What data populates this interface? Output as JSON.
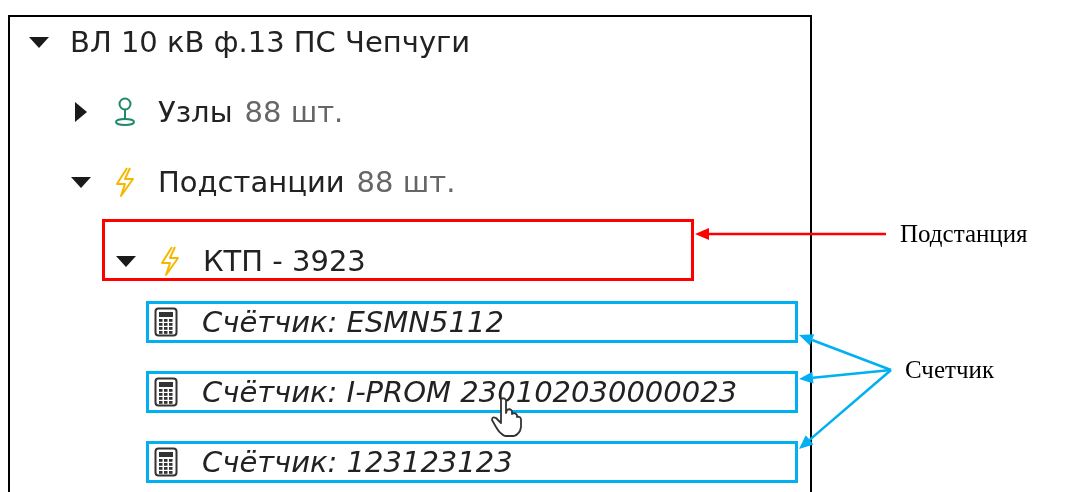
{
  "tree": [
    {
      "label": "ВЛ 10 кВ ф.13 ПС Чепчуги",
      "expanded": true,
      "children": [
        {
          "label": "Узлы",
          "count": "88 шт.",
          "kind": "nodes",
          "expanded": false
        },
        {
          "label": "Подстанции",
          "count": "88 шт.",
          "kind": "substations",
          "expanded": true,
          "children": [
            {
              "label": "КТП - 3923",
              "kind": "substation",
              "expanded": true,
              "marked": true,
              "children": [
                {
                  "label": "Счётчик: ESMN5112",
                  "kind": "meter",
                  "marked": true
                },
                {
                  "label": "Счётчик: I-PROM 230102030000023",
                  "kind": "meter",
                  "marked": true
                },
                {
                  "label": "Счётчик: 123123123",
                  "kind": "meter",
                  "marked": true
                }
              ]
            }
          ]
        }
      ]
    }
  ],
  "callouts": [
    {
      "label": "Подстанция",
      "kind": "substation",
      "color": "#ff0000"
    },
    {
      "label": "Счетчик",
      "kind": "meter",
      "color": "#00b0f0"
    }
  ]
}
